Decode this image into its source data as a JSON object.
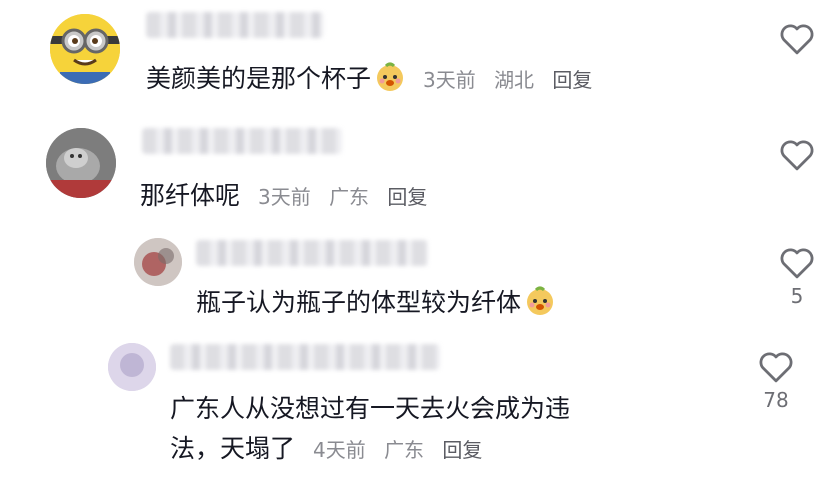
{
  "comments": [
    {
      "text": "美颜美的是那个杯子",
      "has_emoji": true,
      "time": "3天前",
      "location": "湖北",
      "reply": "回复",
      "likes": ""
    },
    {
      "text": "那纤体呢",
      "has_emoji": false,
      "time": "3天前",
      "location": "广东",
      "reply": "回复",
      "likes": ""
    },
    {
      "text": "瓶子认为瓶子的体型较为纤体",
      "has_emoji": true,
      "likes": "5"
    },
    {
      "text_line1": "广东人从没想过有一天去火会成为违",
      "text_line2": "法，天塌了",
      "time": "4天前",
      "location": "广东",
      "reply": "回复",
      "likes": "78"
    }
  ],
  "icons": {
    "like": "heart-outline-icon",
    "emoji": "smiling-face-emoji-icon"
  },
  "colors": {
    "text": "#161823",
    "meta": "#8a8b91",
    "icon": "#6d6e74"
  }
}
